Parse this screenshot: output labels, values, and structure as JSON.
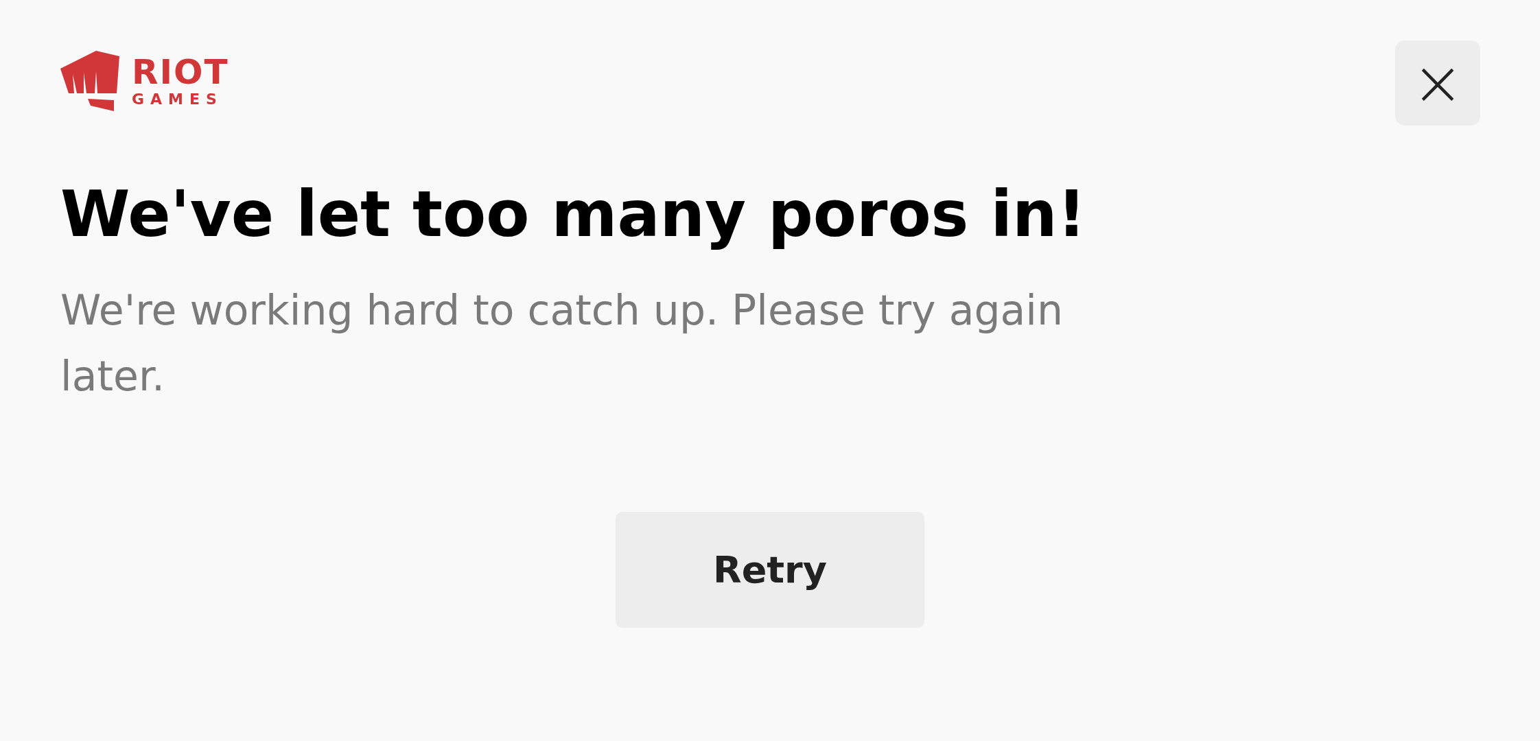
{
  "logo": {
    "word": "RIOT",
    "subword": "GAMES"
  },
  "close_button": {
    "label": "×"
  },
  "title": "We've let too many poros in!",
  "message": "We're working hard to catch up. Please try again later.",
  "buttons": [
    {
      "label": "Retry"
    }
  ]
}
